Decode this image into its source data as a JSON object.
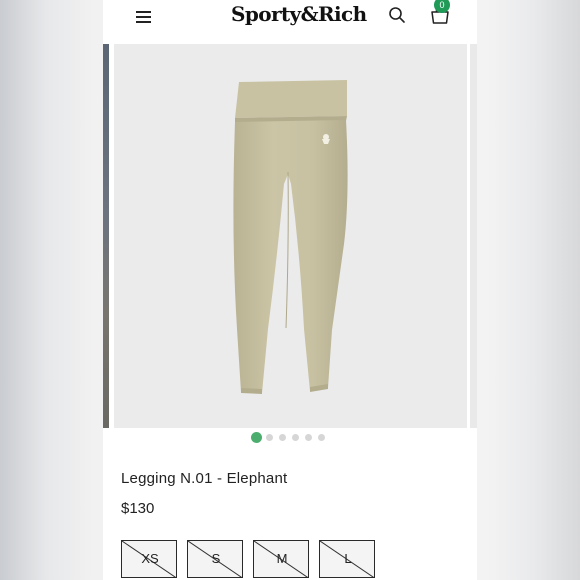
{
  "header": {
    "logo": "Sporty&Rich",
    "menu_icon": "hamburger-menu-icon",
    "search_icon": "search-icon",
    "cart_icon": "shopping-bag-icon",
    "cart_count": "0",
    "badge_color": "#1f9a57"
  },
  "gallery": {
    "slide_count": 6,
    "active_index": 0,
    "active_dot_color": "#4cae6e",
    "product_color": "#c9c3a3"
  },
  "product": {
    "title": "Legging N.01 - Elephant",
    "price": "$130",
    "sizes": [
      {
        "label": "XS",
        "available": false
      },
      {
        "label": "S",
        "available": false
      },
      {
        "label": "M",
        "available": false
      },
      {
        "label": "L",
        "available": false
      }
    ]
  }
}
